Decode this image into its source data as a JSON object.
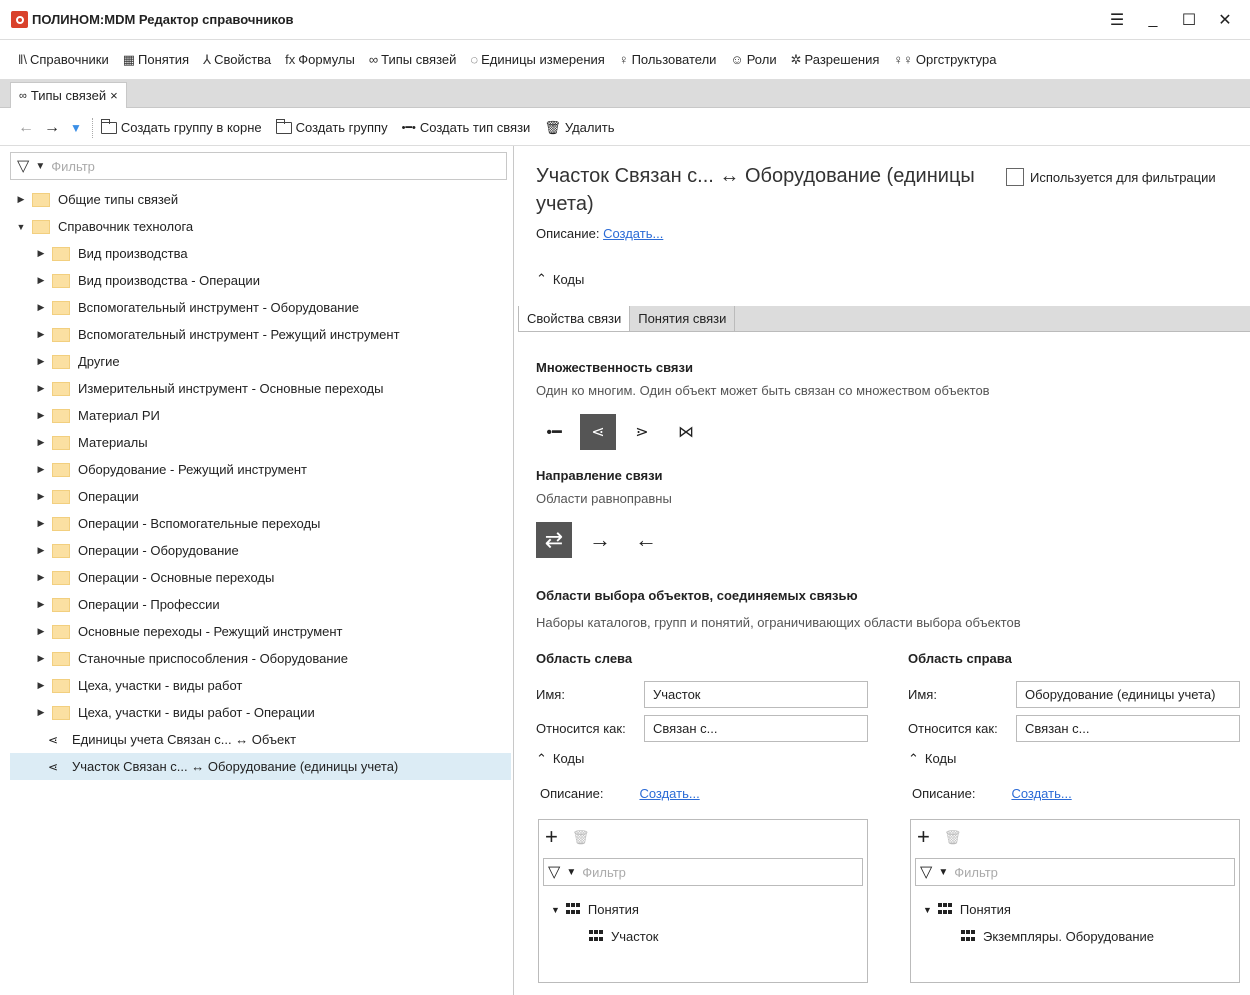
{
  "window": {
    "title": "ПОЛИНОМ:MDM Редактор справочников"
  },
  "menu": [
    {
      "icon": "ǁ\\",
      "label": "Справочники",
      "name": "menu-catalogs"
    },
    {
      "icon": "▦",
      "label": "Понятия",
      "name": "menu-concepts"
    },
    {
      "icon": "⅄",
      "label": "Свойства",
      "name": "menu-properties"
    },
    {
      "icon": "fx",
      "label": "Формулы",
      "name": "menu-formulas"
    },
    {
      "icon": "∞",
      "label": "Типы связей",
      "name": "menu-link-types"
    },
    {
      "icon": "◌",
      "label": "Единицы измерения",
      "name": "menu-units"
    },
    {
      "icon": "♀",
      "label": "Пользователи",
      "name": "menu-users"
    },
    {
      "icon": "☺",
      "label": "Роли",
      "name": "menu-roles"
    },
    {
      "icon": "✲",
      "label": "Разрешения",
      "name": "menu-permissions"
    },
    {
      "icon": "♀♀",
      "label": "Оргструктура",
      "name": "menu-org"
    }
  ],
  "doc_tab": {
    "label": "Типы связей",
    "close": "×"
  },
  "toolbar": {
    "create_root_group": "Создать группу в корне",
    "create_group": "Создать группу",
    "create_link_type": "Создать тип связи",
    "delete": "Удалить"
  },
  "left_filter": {
    "placeholder": "Фильтр"
  },
  "tree": [
    {
      "label": "Общие типы связей",
      "arrow": "▶",
      "type": "folder-special"
    },
    {
      "label": "Справочник технолога",
      "arrow": "▼",
      "type": "folder",
      "expanded": true
    },
    {
      "label": "Вид производства",
      "arrow": "▶",
      "type": "folder",
      "indent": 1
    },
    {
      "label": "Вид производства - Операции",
      "arrow": "▶",
      "type": "folder",
      "indent": 1
    },
    {
      "label": "Вспомогательный инструмент - Оборудование",
      "arrow": "▶",
      "type": "folder",
      "indent": 1
    },
    {
      "label": "Вспомогательный инструмент - Режущий инструмент",
      "arrow": "▶",
      "type": "folder",
      "indent": 1
    },
    {
      "label": "Другие",
      "arrow": "▶",
      "type": "folder",
      "indent": 1
    },
    {
      "label": "Измерительный инструмент - Основные переходы",
      "arrow": "▶",
      "type": "folder",
      "indent": 1
    },
    {
      "label": "Материал РИ",
      "arrow": "▶",
      "type": "folder",
      "indent": 1
    },
    {
      "label": "Материалы",
      "arrow": "▶",
      "type": "folder",
      "indent": 1
    },
    {
      "label": "Оборудование - Режущий инструмент",
      "arrow": "▶",
      "type": "folder",
      "indent": 1
    },
    {
      "label": "Операции",
      "arrow": "▶",
      "type": "folder",
      "indent": 1
    },
    {
      "label": "Операции - Вспомогательные переходы",
      "arrow": "▶",
      "type": "folder",
      "indent": 1
    },
    {
      "label": "Операции - Оборудование",
      "arrow": "▶",
      "type": "folder",
      "indent": 1
    },
    {
      "label": "Операции - Основные переходы",
      "arrow": "▶",
      "type": "folder",
      "indent": 1
    },
    {
      "label": "Операции - Профессии",
      "arrow": "▶",
      "type": "folder",
      "indent": 1
    },
    {
      "label": "Основные переходы - Режущий инструмент",
      "arrow": "▶",
      "type": "folder",
      "indent": 1
    },
    {
      "label": "Станочные приспособления - Оборудование",
      "arrow": "▶",
      "type": "folder",
      "indent": 1
    },
    {
      "label": "Цеха, участки - виды работ",
      "arrow": "▶",
      "type": "folder",
      "indent": 1
    },
    {
      "label": "Цеха, участки - виды работ - Операции",
      "arrow": "▶",
      "type": "folder",
      "indent": 1
    },
    {
      "label": "Единицы учета Связан с... ↔ Объект",
      "arrow": "",
      "type": "link",
      "indent": 1
    },
    {
      "label": "Участок Связан с... ↔ Оборудование (единицы учета)",
      "arrow": "",
      "type": "link",
      "indent": 1,
      "selected": true
    }
  ],
  "detail": {
    "title": "Участок Связан с... ↔ Оборудование (единицы учета)",
    "used_for_filter": "Используется для фильтрации",
    "description_label": "Описание:",
    "create_link": "Создать...",
    "codes": "Коды",
    "tabs": [
      "Свойства связи",
      "Понятия связи"
    ],
    "multiplicity_title": "Множественность связи",
    "multiplicity_desc": "Один ко многим. Один объект может быть связан со множеством объектов",
    "direction_title": "Направление связи",
    "direction_desc": "Области равноправны",
    "areas_title": "Области выбора объектов, соединяемых связью",
    "areas_desc": "Наборы каталогов, групп и понятий, ограничивающих области выбора объектов"
  },
  "left_area": {
    "title": "Область слева",
    "name_label": "Имя:",
    "name_value": "Участок",
    "relates_label": "Относится как:",
    "relates_value": "Связан с...",
    "codes": "Коды",
    "description_label": "Описание:",
    "create_link": "Создать...",
    "filter_placeholder": "Фильтр",
    "tree_root": "Понятия",
    "tree_child": "Участок"
  },
  "right_area": {
    "title": "Область справа",
    "name_label": "Имя:",
    "name_value": "Оборудование (единицы учета)",
    "relates_label": "Относится как:",
    "relates_value": "Связан с...",
    "codes": "Коды",
    "description_label": "Описание:",
    "create_link": "Создать...",
    "filter_placeholder": "Фильтр",
    "tree_root": "Понятия",
    "tree_child": "Экземпляры. Оборудование"
  }
}
